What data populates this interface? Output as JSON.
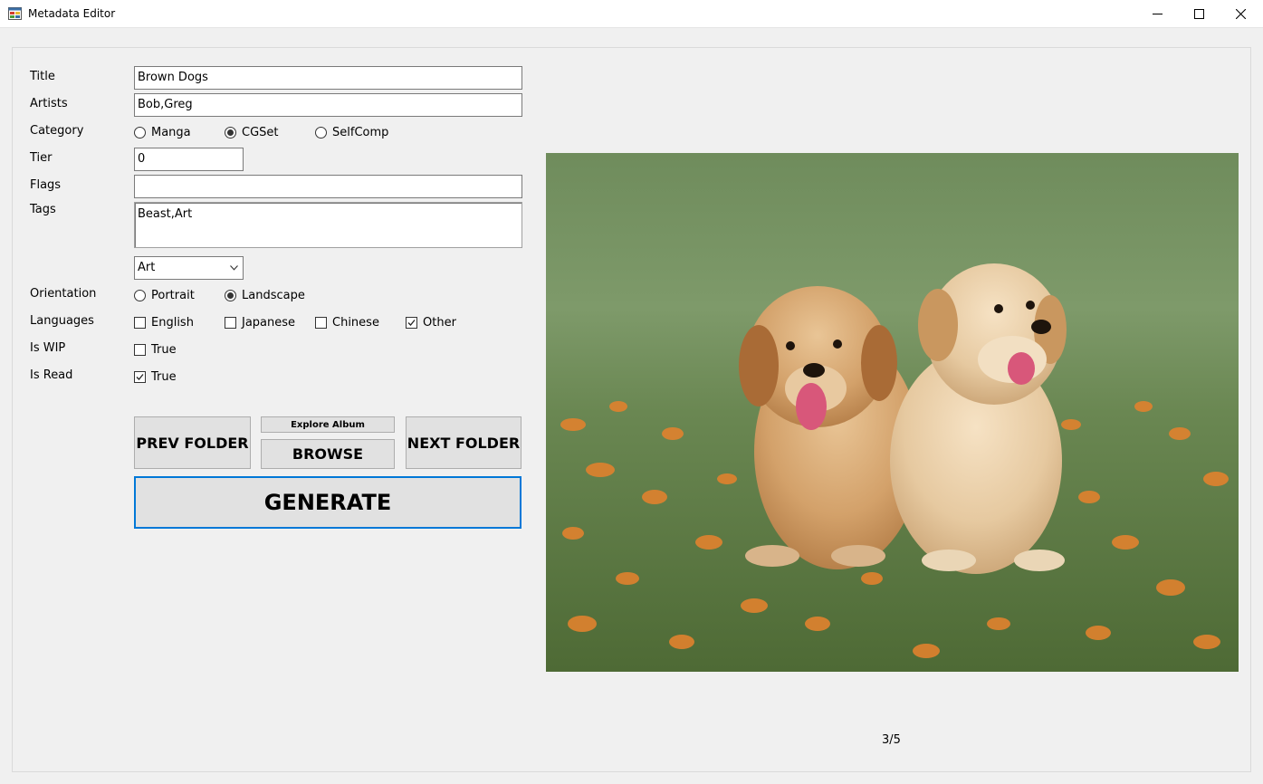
{
  "window": {
    "title": "Metadata Editor",
    "icon": "app-icon",
    "controls": [
      "minimize-icon",
      "maximize-icon",
      "close-icon"
    ]
  },
  "form": {
    "title_label": "Title",
    "title_value": "Brown Dogs",
    "artists_label": "Artists",
    "artists_value": "Bob,Greg",
    "category_label": "Category",
    "category_options": [
      "Manga",
      "CGSet",
      "SelfComp"
    ],
    "category_selected": "CGSet",
    "tier_label": "Tier",
    "tier_value": "0",
    "flags_label": "Flags",
    "flags_value": "",
    "tags_label": "Tags",
    "tags_value": "Beast,Art",
    "tag_dropdown_value": "Art",
    "orientation_label": "Orientation",
    "orientation_options": [
      "Portrait",
      "Landscape"
    ],
    "orientation_selected": "Landscape",
    "languages_label": "Languages",
    "languages": [
      {
        "label": "English",
        "checked": false
      },
      {
        "label": "Japanese",
        "checked": false
      },
      {
        "label": "Chinese",
        "checked": false
      },
      {
        "label": "Other",
        "checked": true
      }
    ],
    "wip_label": "Is WIP",
    "wip_option": "True",
    "wip_checked": false,
    "read_label": "Is Read",
    "read_option": "True",
    "read_checked": true
  },
  "buttons": {
    "prev_folder": "PREV FOLDER",
    "explore_album": "Explore Album",
    "browse": "BROWSE",
    "next_folder": "NEXT FOLDER",
    "generate": "GENERATE"
  },
  "preview": {
    "icon": "photo-of-two-puppies-in-flower-field",
    "counter": "3/5"
  },
  "colors": {
    "accent": "#0078d7",
    "window_bg": "#f0f0f0",
    "button_bg": "#e1e1e1"
  }
}
